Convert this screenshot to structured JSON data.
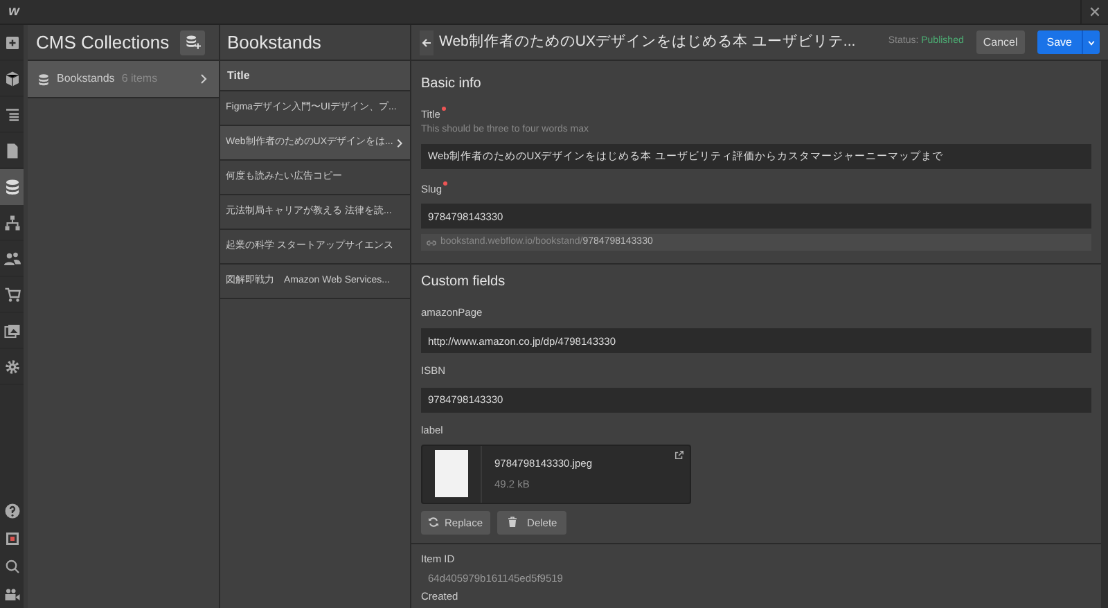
{
  "logo": "w",
  "rail": {
    "top": [
      {
        "selected": false
      },
      {
        "selected": false
      },
      {
        "selected": false
      },
      {
        "selected": false
      },
      {
        "selected": true
      },
      {
        "selected": false
      },
      {
        "selected": false
      },
      {
        "selected": false
      },
      {
        "selected": false
      },
      {
        "selected": false
      }
    ],
    "bottom": [
      {
        "selected": false
      },
      {
        "selected": false
      },
      {
        "selected": false
      },
      {
        "selected": false
      }
    ]
  },
  "collections": {
    "title": "CMS Collections",
    "items": [
      {
        "name": "Bookstands",
        "count": "6 items",
        "selected": true
      }
    ]
  },
  "items_panel": {
    "title": "Bookstands",
    "column": "Title",
    "rows": [
      {
        "title": "Figmaデザイン入門〜UIデザイン、プ...",
        "selected": false
      },
      {
        "title": "Web制作者のためのUXデザインをは...",
        "selected": true
      },
      {
        "title": "何度も読みたい広告コピー",
        "selected": false
      },
      {
        "title": "元法制局キャリアが教える 法律を読...",
        "selected": false
      },
      {
        "title": "起業の科学 スタートアップサイエンス",
        "selected": false
      },
      {
        "title": "図解即戦力　Amazon Web Services...",
        "selected": false
      }
    ]
  },
  "editor": {
    "title": "Web制作者のためのUXデザインをはじめる本 ユーザビリテ...",
    "status_label": "Status:",
    "status": "Published",
    "cancel": "Cancel",
    "save": "Save",
    "basic_heading": "Basic info",
    "title_field": {
      "label": "Title",
      "required": true,
      "hint": "This should be three to four words max",
      "value": "Web制作者のためのUXデザインをはじめる本 ユーザビリティ評価からカスタマージャーニーマップまで"
    },
    "slug_field": {
      "label": "Slug",
      "required": true,
      "value": "9784798143330",
      "url_base": "bookstand.webflow.io/bookstand/",
      "url_slug": "9784798143330"
    },
    "custom_heading": "Custom fields",
    "amazon_field": {
      "label": "amazonPage",
      "value": "http://www.amazon.co.jp/dp/4798143330"
    },
    "isbn_field": {
      "label": "ISBN",
      "value": "9784798143330"
    },
    "image_field": {
      "label": "label",
      "file_name": "9784798143330.jpeg",
      "file_size": "49.2 kB",
      "replace": "Replace",
      "delete": "Delete"
    },
    "item_id_label": "Item ID",
    "item_id": "64d405979b161145ed5f9519",
    "created_label": "Created"
  }
}
